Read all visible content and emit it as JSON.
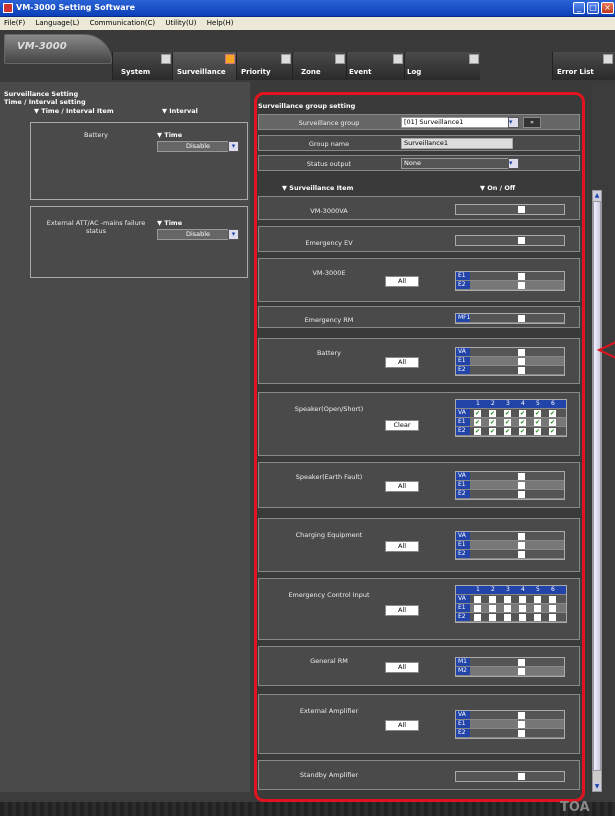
{
  "window": {
    "title": "VM-3000 Setting Software"
  },
  "menu": [
    "File(F)",
    "Language(L)",
    "Communication(C)",
    "Utility(U)",
    "Help(H)"
  ],
  "logo": "VM-3000",
  "tabs": [
    "System",
    "Surveillance",
    "Priority",
    "Zone",
    "Event",
    "Log",
    "Error List"
  ],
  "left": {
    "title": "Surveillance Setting",
    "subtitle": "Time / Interval setting",
    "col1": "▼ Time / Interval Item",
    "col2": "▼ Interval",
    "items": [
      {
        "name": "Battery",
        "time_label": "▼ Time",
        "value": "Disable"
      },
      {
        "name": "External ATT/AC -mains failure status",
        "time_label": "▼ Time",
        "value": "Disable"
      }
    ]
  },
  "right": {
    "title": "Surveillance group setting",
    "group_label": "Surveillance group",
    "group_value": "[01] Surveillance1",
    "name_label": "Group name",
    "name_value": "Surveillance1",
    "status_label": "Status output",
    "status_value": "None",
    "col1": "▼ Surveillance Item",
    "col2": "▼ On / Off",
    "all": "All",
    "clear": "Clear",
    "items": [
      "VM-3000VA",
      "Emergency EV",
      "VM-3000E",
      "Emergency RM",
      "Battery",
      "Speaker(Open/Short)",
      "Speaker(Earth Fault)",
      "Charging Equipment",
      "Emergency Control Input",
      "General RM",
      "External Amplifier",
      "Standby Amplifier"
    ],
    "tags": {
      "va": "VA",
      "e1": "E1",
      "e2": "E2",
      "mf1": "MF1",
      "m1": "M1",
      "m2": "M2"
    },
    "cols": [
      "1",
      "2",
      "3",
      "4",
      "5",
      "6"
    ]
  },
  "brand": "TOA",
  "colors": {
    "accent": "#f5a623",
    "frame": "#e0141e",
    "tag": "#2243a8"
  }
}
